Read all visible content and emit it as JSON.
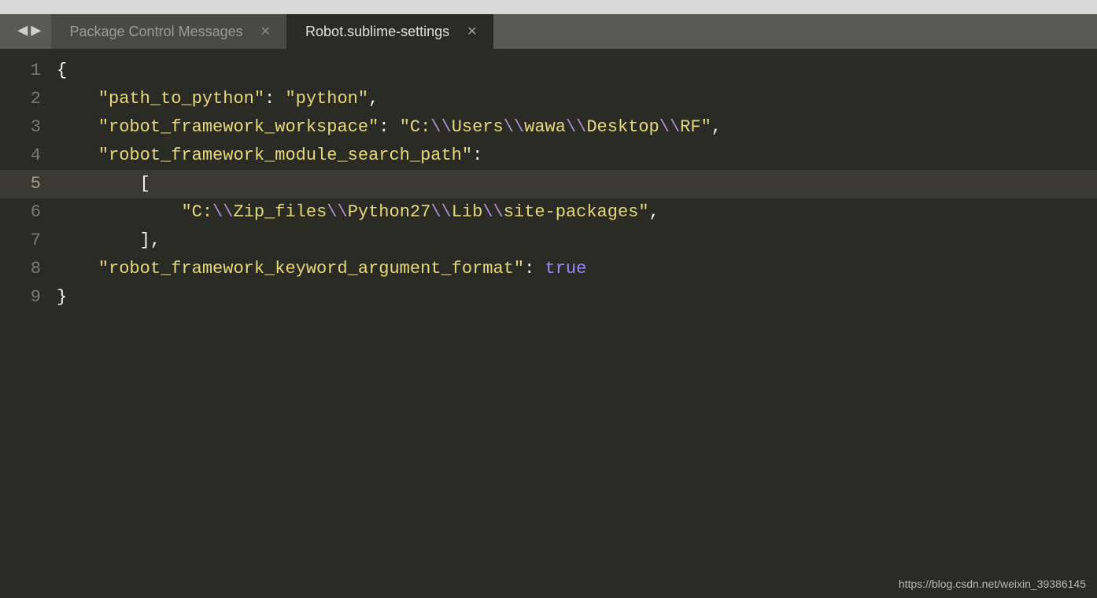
{
  "tabs": [
    {
      "label": "Package Control Messages",
      "active": false
    },
    {
      "label": "Robot.sublime-settings",
      "active": true
    }
  ],
  "line_numbers": [
    "1",
    "2",
    "3",
    "4",
    "5",
    "6",
    "7",
    "8",
    "9"
  ],
  "highlighted_line": "5",
  "code": {
    "l1_brace": "{",
    "l2_key": "\"path_to_python\"",
    "l2_val": "\"python\"",
    "l3_key": "\"robot_framework_workspace\"",
    "l3_val_a": "\"C:",
    "l3_e1": "\\\\",
    "l3_val_b": "Users",
    "l3_e2": "\\\\",
    "l3_val_c": "wawa",
    "l3_e3": "\\\\",
    "l3_val_d": "Desktop",
    "l3_e4": "\\\\",
    "l3_val_e": "RF\"",
    "l4_key": "\"robot_framework_module_search_path\"",
    "l5_bracket": "[",
    "l6_val_a": "\"C:",
    "l6_e1": "\\\\",
    "l6_val_b": "Zip_files",
    "l6_e2": "\\\\",
    "l6_val_c": "Python27",
    "l6_e3": "\\\\",
    "l6_val_d": "Lib",
    "l6_e4": "\\\\",
    "l6_val_e": "site-packages\"",
    "l7_bracket": "],",
    "l8_key": "\"robot_framework_keyword_argument_format\"",
    "l8_kw": "true",
    "l9_brace": "}",
    "colon": ":",
    "comma": ",",
    "sp1": "    ",
    "sp2": "        ",
    "sp3": "            "
  },
  "watermark": "https://blog.csdn.net/weixin_39386145"
}
